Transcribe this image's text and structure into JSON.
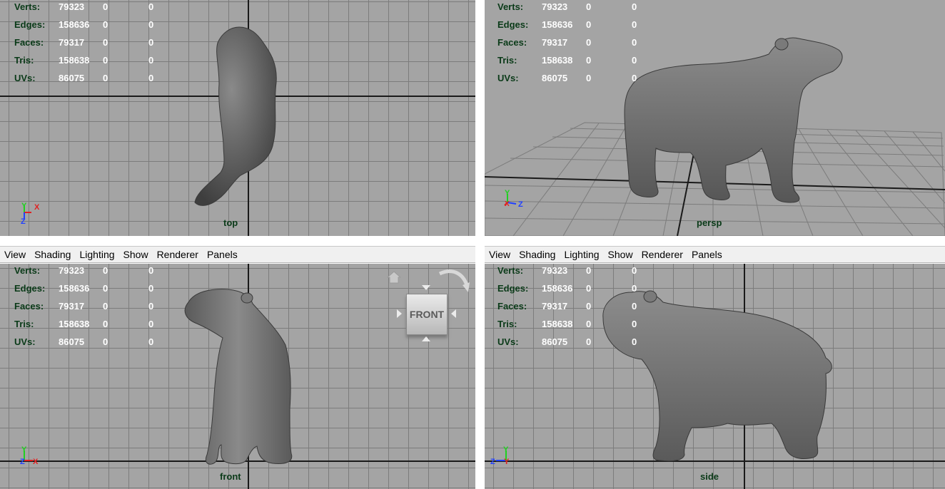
{
  "hud_rows": [
    {
      "label": "Verts:",
      "v1": "79323",
      "v2": "0",
      "v3": "0"
    },
    {
      "label": "Edges:",
      "v1": "158636",
      "v2": "0",
      "v3": "0"
    },
    {
      "label": "Faces:",
      "v1": "79317",
      "v2": "0",
      "v3": "0"
    },
    {
      "label": "Tris:",
      "v1": "158638",
      "v2": "0",
      "v3": "0"
    },
    {
      "label": "UVs:",
      "v1": "86075",
      "v2": "0",
      "v3": "0"
    }
  ],
  "menu": {
    "view": "View",
    "shading": "Shading",
    "lighting": "Lighting",
    "show": "Show",
    "renderer": "Renderer",
    "panels": "Panels"
  },
  "viewports": {
    "top": {
      "camera": "top",
      "axis_a": "Y",
      "axis_b": "X",
      "axis_c": "Z"
    },
    "persp": {
      "camera": "persp",
      "axis_a": "Y",
      "axis_b": "X",
      "axis_c": "Z"
    },
    "front": {
      "camera": "front",
      "axis_a": "Y",
      "axis_b": "Z",
      "axis_c": "X"
    },
    "side": {
      "camera": "side",
      "axis_a": "Y",
      "axis_b": "Z",
      "axis_c": "Y"
    }
  },
  "view_cube": {
    "face_label": "FRONT"
  },
  "colors": {
    "viewport_bg": "#a4a4a4",
    "grid": "#7c7c7c",
    "hud_label": "#0a3a18",
    "axis_x": "#e02020",
    "axis_y": "#20d020",
    "axis_z": "#2040ff"
  }
}
